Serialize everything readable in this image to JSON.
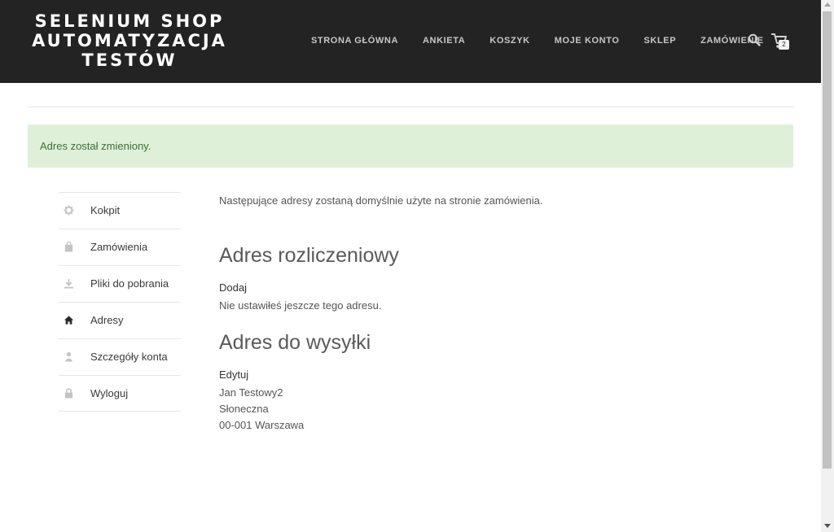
{
  "site": {
    "logo_lines": [
      "SELENIUM SHOP",
      "AUTOMATYZACJA",
      "TESTÓW"
    ]
  },
  "nav": {
    "items": [
      "STRONA GŁÓWNA",
      "ANKIETA",
      "KOSZYK",
      "MOJE KONTO",
      "SKLEP",
      "ZAMÓWIENIE"
    ],
    "cart_count": "2"
  },
  "notice": {
    "message": "Adres został zmieniony."
  },
  "sidebar": {
    "items": [
      {
        "label": "Kokpit",
        "icon": "gear-icon"
      },
      {
        "label": "Zamówienia",
        "icon": "bag-icon"
      },
      {
        "label": "Pliki do pobrania",
        "icon": "download-icon"
      },
      {
        "label": "Adresy",
        "icon": "home-icon",
        "active": true
      },
      {
        "label": "Szczegóły konta",
        "icon": "user-icon"
      },
      {
        "label": "Wyloguj",
        "icon": "lock-icon"
      }
    ]
  },
  "content": {
    "intro": "Następujące adresy zostaną domyślnie użyte na stronie zamówienia.",
    "billing": {
      "heading": "Adres rozliczeniowy",
      "action": "Dodaj",
      "empty_text": "Nie ustawiłeś jeszcze tego adresu."
    },
    "shipping": {
      "heading": "Adres do wysyłki",
      "action": "Edytuj",
      "lines": [
        "Jan Testowy2",
        "Słoneczna",
        "00-001 Warszawa"
      ]
    }
  },
  "colors": {
    "header_bg": "#232323",
    "notice_bg": "#dff0d8",
    "notice_text": "#3c6e3c"
  }
}
